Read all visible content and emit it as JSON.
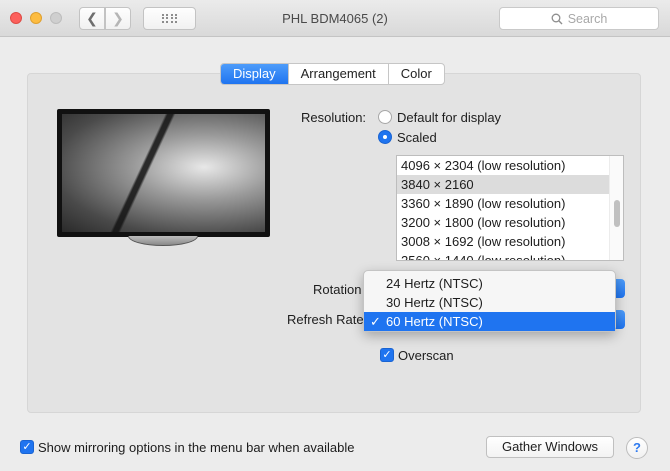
{
  "window": {
    "title": "PHL BDM4065 (2)"
  },
  "toolbar": {
    "search_placeholder": "Search"
  },
  "tabs": [
    {
      "label": "Display",
      "active": true
    },
    {
      "label": "Arrangement",
      "active": false
    },
    {
      "label": "Color",
      "active": false
    }
  ],
  "resolution": {
    "label": "Resolution:",
    "options": [
      {
        "label": "Default for display",
        "selected": false
      },
      {
        "label": "Scaled",
        "selected": true
      }
    ],
    "list": [
      "4096 × 2304 (low resolution)",
      "3840 × 2160",
      "3360 × 1890 (low resolution)",
      "3200 × 1800 (low resolution)",
      "3008 × 1692 (low resolution)",
      "2560 × 1440 (low resolution)"
    ],
    "selected_index": 1
  },
  "rotation": {
    "label": "Rotation"
  },
  "refresh_rate": {
    "label": "Refresh Rate",
    "options": [
      "24 Hertz (NTSC)",
      "30 Hertz (NTSC)",
      "60 Hertz (NTSC)"
    ],
    "selected_index": 2,
    "check_mark": "✓"
  },
  "overscan": {
    "label": "Overscan",
    "checked": true
  },
  "footer": {
    "mirroring_label": "Show mirroring options in the menu bar when available",
    "mirroring_checked": true,
    "gather_button": "Gather Windows",
    "help_label": "?"
  },
  "colors": {
    "accent": "#1f74f0",
    "close": "#fc605c",
    "minimize": "#fdbc40"
  }
}
